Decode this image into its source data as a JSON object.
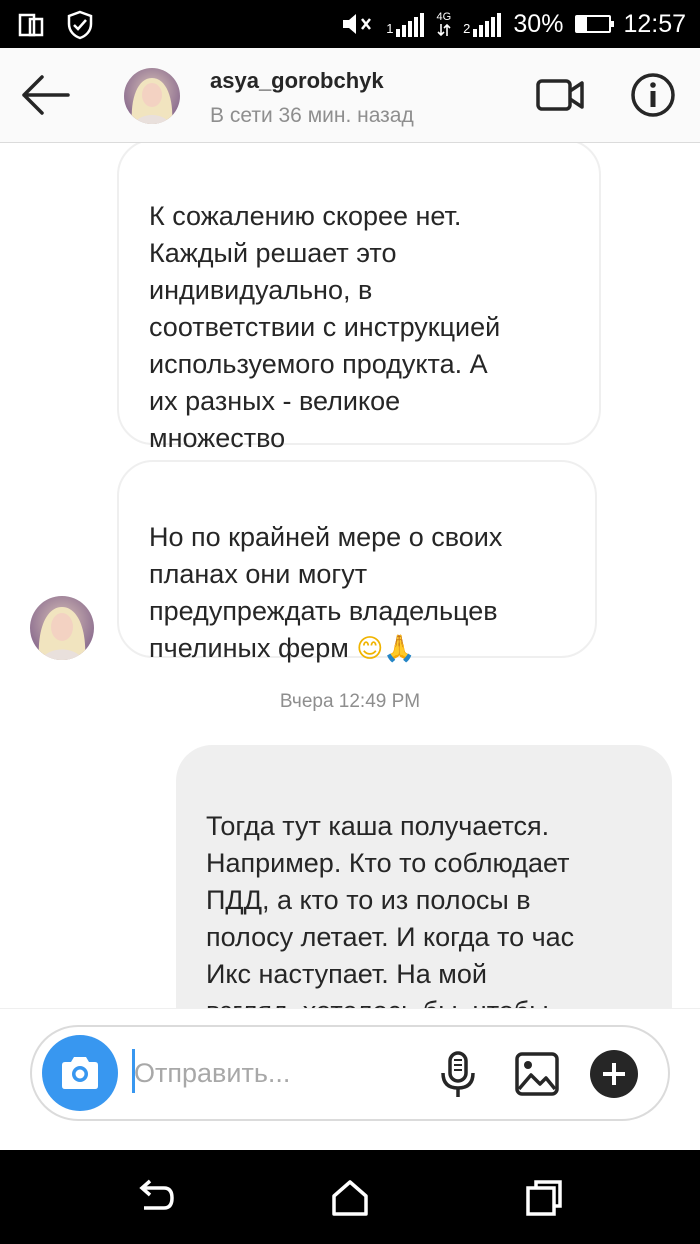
{
  "status_bar": {
    "sim1": "1",
    "sim2": "2",
    "network": "4G",
    "battery_percent": "30%",
    "battery_level": 0.3,
    "time": "12:57"
  },
  "header": {
    "username": "asya_gorobchyk",
    "presence": "В сети 36 мин. назад"
  },
  "messages": [
    {
      "direction": "incoming",
      "text": "К сожалению скорее нет.\nКаждый решает это\nиндивидуально, в\nсоответствии с инструкцией\nиспользуемого продукта. А\nих разных - великое\nмножество"
    },
    {
      "direction": "incoming",
      "text": "Но по крайней мере о своих\nпланах они могут\nпредупреждать владельцев\nпчелиных ферм",
      "emoji": "😊🙏"
    },
    {
      "direction": "outgoing",
      "text": "Тогда тут каша  получается.\nНапример. Кто то соблюдает\nПДД, а кто то из полосы в\nполосу летает. И когда то час\nИкс наступает. На мой\nвзгляд, хотелось бы, чтобы\nбыл госрегламент"
    }
  ],
  "timestamp": "Вчера 12:49 PM",
  "composer": {
    "placeholder": "Отправить..."
  },
  "colors": {
    "accent": "#3897f0",
    "incoming_border": "#efefef",
    "outgoing_bg": "#efefef",
    "secondary_text": "#8e8e8e"
  },
  "icons": [
    "back-arrow-icon",
    "video-call-icon",
    "info-icon",
    "camera-icon",
    "microphone-icon",
    "gallery-icon",
    "plus-icon",
    "nav-back-icon",
    "nav-home-icon",
    "nav-recents-icon"
  ]
}
